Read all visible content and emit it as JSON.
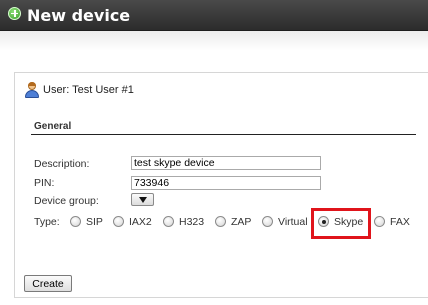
{
  "header": {
    "title": "New device",
    "icon": "add-circle-icon"
  },
  "user": {
    "icon": "user-icon",
    "label": "User: Test User #1"
  },
  "section": {
    "title": "General"
  },
  "form": {
    "description_label": "Description:",
    "description_value": "test skype device",
    "pin_label": "PIN:",
    "pin_value": "733946",
    "device_group_label": "Device group:",
    "type_label": "Type:",
    "type_options": [
      "SIP",
      "IAX2",
      "H323",
      "ZAP",
      "Virtual",
      "Skype",
      "FAX"
    ],
    "type_selected": "Skype"
  },
  "actions": {
    "create_label": "Create"
  },
  "colors": {
    "header_bg": "#333333",
    "highlight": "#e0141b"
  }
}
